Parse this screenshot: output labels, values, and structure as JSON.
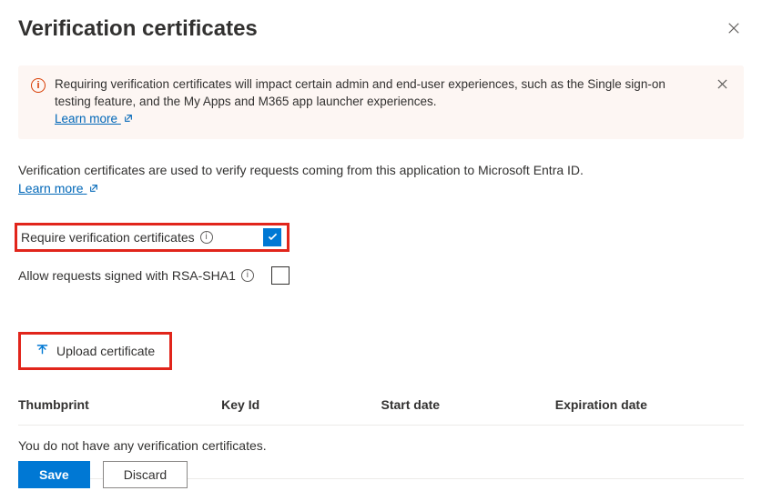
{
  "page": {
    "title": "Verification certificates"
  },
  "notice": {
    "text": "Requiring verification certificates will impact certain admin and end-user experiences, such as the Single sign-on testing feature, and the My Apps and M365 app launcher experiences.",
    "learn_more": "Learn more"
  },
  "description": {
    "text": "Verification certificates are used to verify requests coming from this application to Microsoft Entra ID.",
    "learn_more": "Learn more"
  },
  "settings": {
    "require_label": "Require verification certificates",
    "require_checked": true,
    "allow_rsa_label": "Allow requests signed with RSA-SHA1",
    "allow_rsa_checked": false
  },
  "upload": {
    "label": "Upload certificate"
  },
  "table": {
    "headers": {
      "thumbprint": "Thumbprint",
      "key_id": "Key Id",
      "start_date": "Start date",
      "expiration_date": "Expiration date"
    },
    "empty_text": "You do not have any verification certificates."
  },
  "footer": {
    "save": "Save",
    "discard": "Discard"
  }
}
